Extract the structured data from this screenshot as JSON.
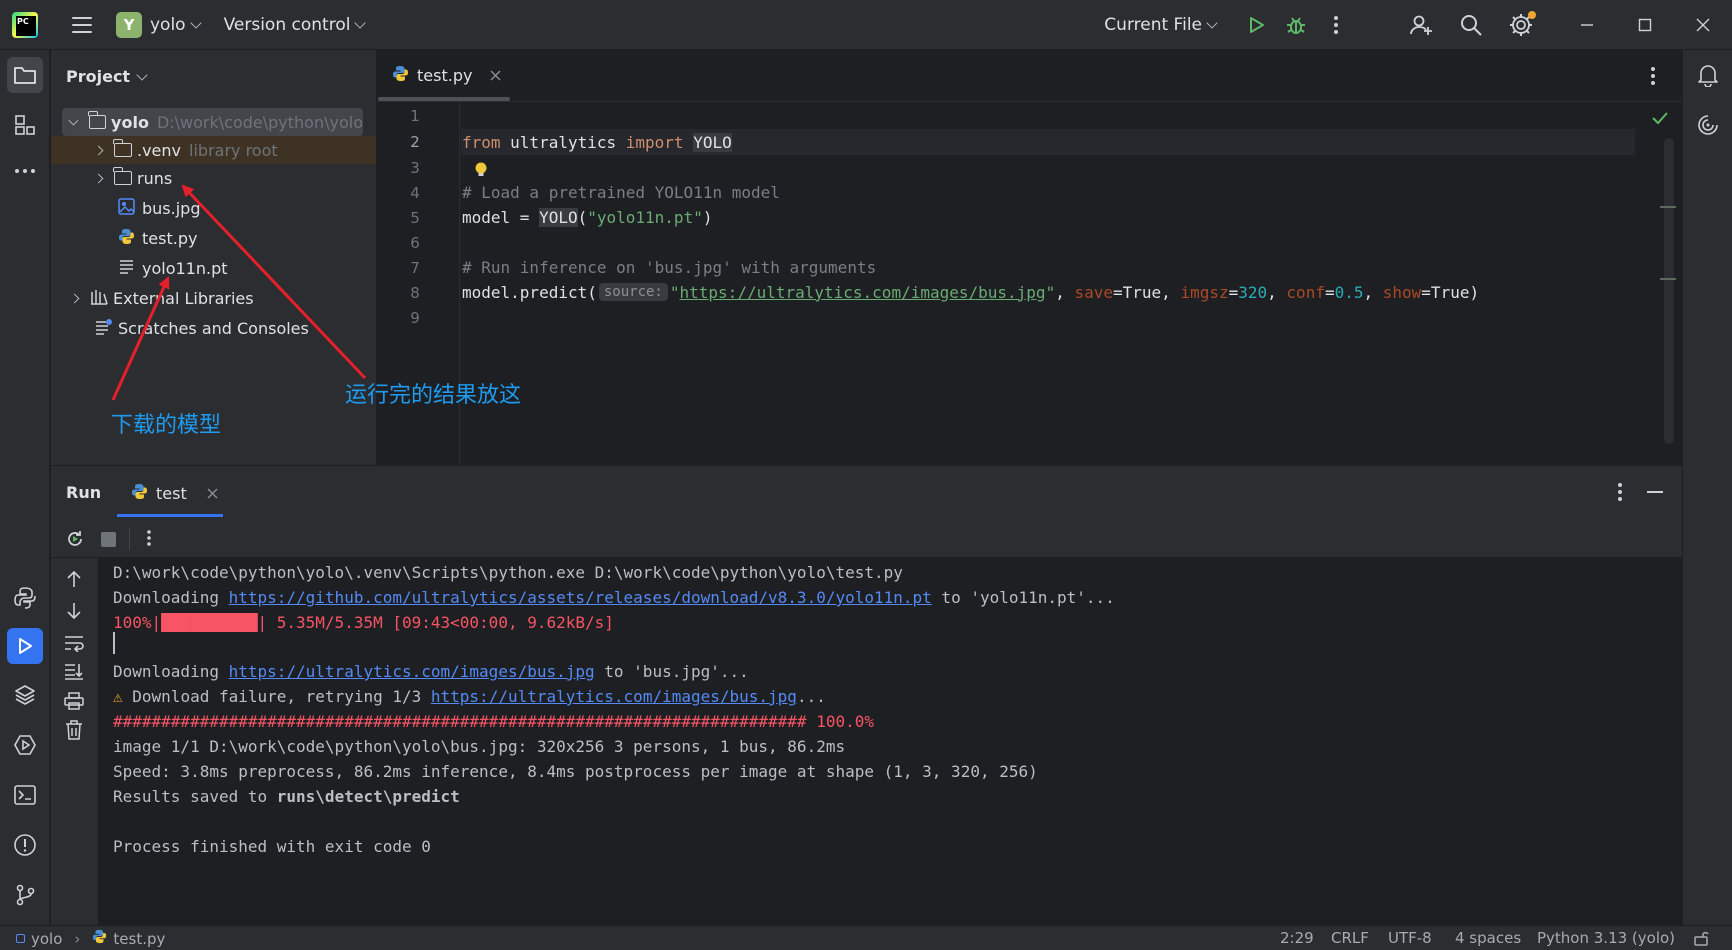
{
  "titlebar": {
    "project_initial": "Y",
    "project_name": "yolo",
    "vcs_label": "Version control",
    "run_config": "Current File"
  },
  "project_panel": {
    "title": "Project",
    "tree": [
      {
        "label": "yolo",
        "hint": "D:\\work\\code\\python\\yolo"
      },
      {
        "label": ".venv",
        "hint": "library root"
      },
      {
        "label": "runs",
        "hint": ""
      },
      {
        "label": "bus.jpg",
        "hint": ""
      },
      {
        "label": "test.py",
        "hint": ""
      },
      {
        "label": "yolo11n.pt",
        "hint": ""
      },
      {
        "label": "External Libraries",
        "hint": ""
      },
      {
        "label": "Scratches and Consoles",
        "hint": ""
      }
    ]
  },
  "editor": {
    "tab_label": "test.py",
    "line_numbers": [
      "1",
      "2",
      "3",
      "4",
      "5",
      "6",
      "7",
      "8",
      "9"
    ],
    "code": {
      "l2_from": "from",
      "l2_mod": " ultralytics ",
      "l2_import": "import",
      "l2_sp": " ",
      "l2_cls": "YOLO",
      "l4": "# Load a pretrained YOLO11n model",
      "l5_a": "model = ",
      "l5_cls": "YOLO",
      "l5_b": "(",
      "l5_str": "\"yolo11n.pt\"",
      "l5_c": ")",
      "l7": "# Run inference on 'bus.jpg' with arguments",
      "l8_a": "model.predict(",
      "l8_inlay": "source:",
      "l8_q1": "\"",
      "l8_url": "https://ultralytics.com/images/bus.jpg",
      "l8_q2": "\"",
      "l8_c1": ", ",
      "l8_p1": "save",
      "l8_e1": "=True, ",
      "l8_p2": "imgsz",
      "l8_e2": "=",
      "l8_n2": "320",
      "l8_c2": ", ",
      "l8_p3": "conf",
      "l8_e3": "=",
      "l8_n3": "0.5",
      "l8_c3": ", ",
      "l8_p4": "show",
      "l8_e4": "=True)"
    }
  },
  "run_panel": {
    "title": "Run",
    "tab_label": "test",
    "console": {
      "l1": "D:\\work\\code\\python\\yolo\\.venv\\Scripts\\python.exe D:\\work\\code\\python\\yolo\\test.py",
      "l2_a": "Downloading ",
      "l2_link": "https://github.com/ultralytics/assets/releases/download/v8.3.0/yolo11n.pt",
      "l2_b": " to 'yolo11n.pt'...",
      "l3": "100%|██████████| 5.35M/5.35M [09:43<00:00, 9.62kB/s]",
      "l5_a": "Downloading ",
      "l5_link": "https://ultralytics.com/images/bus.jpg",
      "l5_b": " to 'bus.jpg'...",
      "l6_warn": "⚠",
      "l6_a": " Download failure, retrying 1/3 ",
      "l6_link": "https://ultralytics.com/images/bus.jpg",
      "l6_b": "...",
      "l7": "######################################################################## 100.0%",
      "l8": "image 1/1 D:\\work\\code\\python\\yolo\\bus.jpg: 320x256 3 persons, 1 bus, 86.2ms",
      "l9": "Speed: 3.8ms preprocess, 86.2ms inference, 8.4ms postprocess per image at shape (1, 3, 320, 256)",
      "l10_a": "Results saved to ",
      "l10_b": "runs\\detect\\predict",
      "l12": "Process finished with exit code 0"
    }
  },
  "statusbar": {
    "crumb_project": "yolo",
    "crumb_file": "test.py",
    "position": "2:29",
    "line_sep": "CRLF",
    "encoding": "UTF-8",
    "indent": "4 spaces",
    "interpreter": "Python 3.13 (yolo)"
  },
  "annotations": {
    "runs_note": "运行完的结果放这",
    "model_note": "下载的模型"
  },
  "colors": {
    "accent": "#3574f0",
    "annotation": "#1d9bf0",
    "arrow": "#e5202b"
  }
}
